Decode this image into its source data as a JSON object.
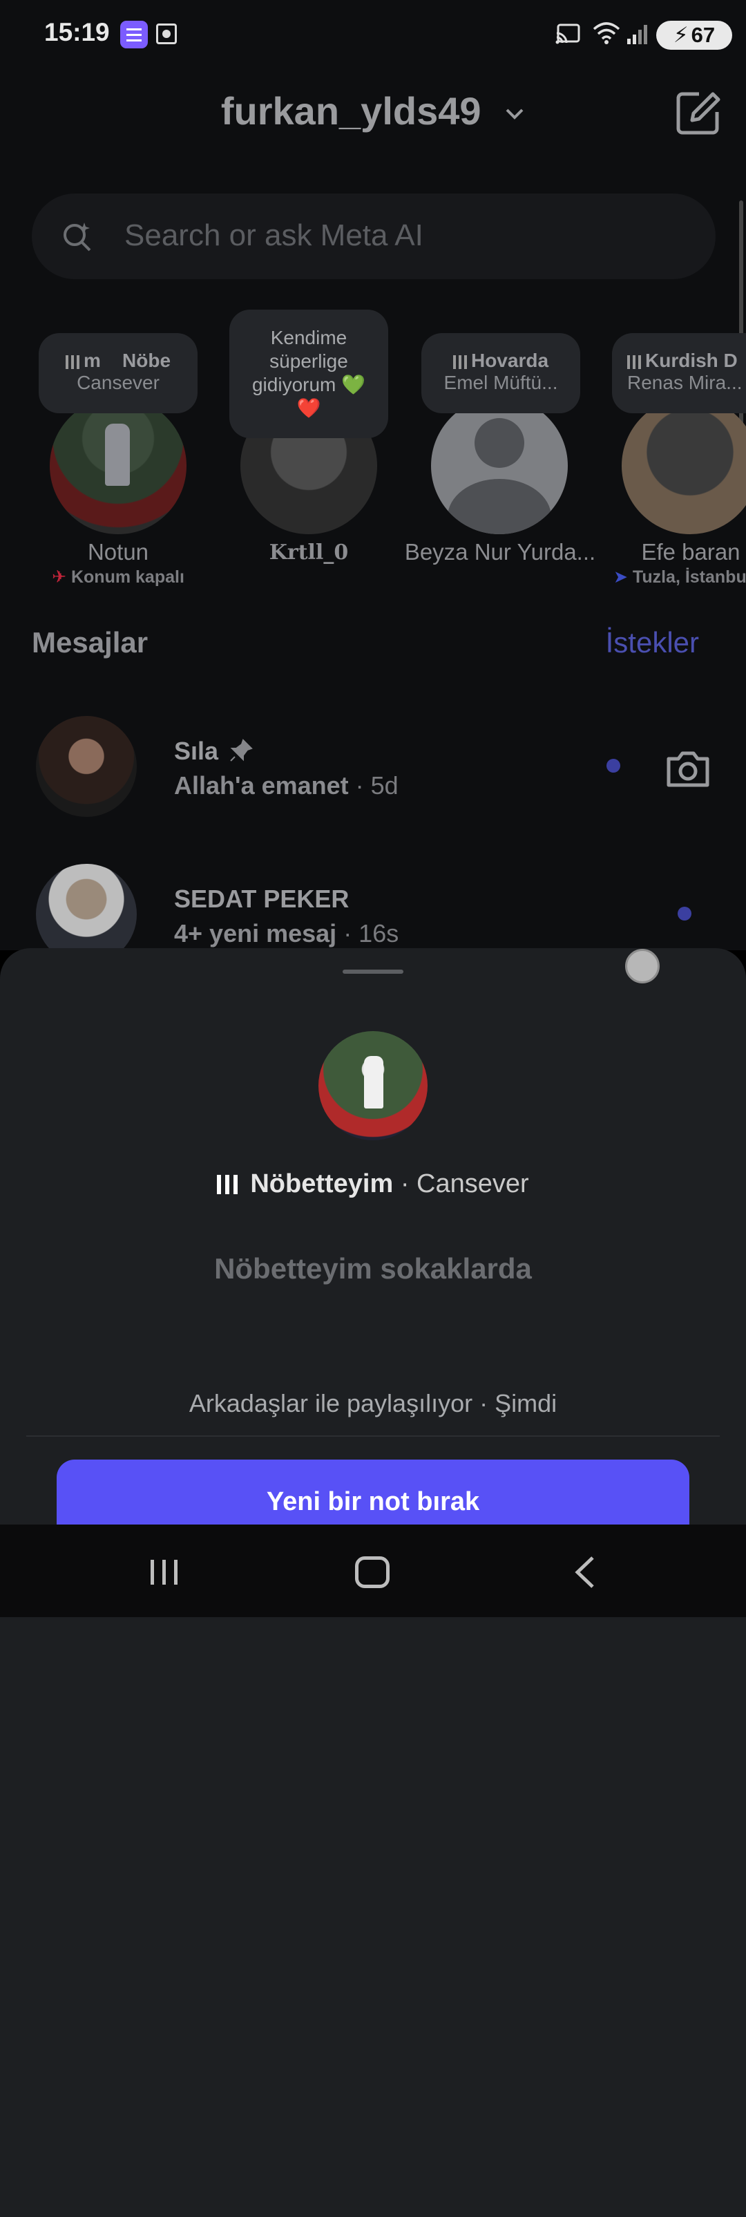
{
  "status_bar": {
    "time": "15:19",
    "battery": "67"
  },
  "header": {
    "title": "furkan_ylds49"
  },
  "search": {
    "placeholder": "Search or ask Meta AI"
  },
  "notes": [
    {
      "bubble_title": "Nöbe",
      "bubble_title_prefix": "m",
      "bubble_sub": "Cansever",
      "name": "Notun",
      "location": "Konum kapalı"
    },
    {
      "bubble_text": "Kendime süperlige gidiyorum 💚 ❤️",
      "name": "Krtll_0"
    },
    {
      "bubble_title": "Hovarda",
      "bubble_sub": "Emel Müftü...",
      "name": "Beyza Nur Yurda..."
    },
    {
      "bubble_title": "Kurdish D",
      "bubble_sub": "Renas Mira...",
      "name": "Efe baran",
      "location": "Tuzla, İstanbu"
    }
  ],
  "section": {
    "title": "Mesajlar",
    "requests": "İstekler"
  },
  "messages": [
    {
      "name": "Sıla",
      "preview": "Allah'a emanet",
      "time": "· 5d"
    },
    {
      "name": "SEDAT PEKER",
      "preview": "4+ yeni mesaj",
      "time": "· 16s"
    }
  ],
  "sheet": {
    "song": "Nöbetteyim",
    "artist": "· Cansever",
    "note": "Nöbetteyim sokaklarda",
    "shared": "Arkadaşlar ile paylaşılıyor · Şimdi",
    "button": "Yeni bir not bırak"
  },
  "colors": {
    "accent": "#5851f6",
    "sheet_bg": "#1d1f22",
    "requests": "#4a4fb0",
    "unread_dot": "#3b3fa0"
  },
  "icons": [
    "compose-icon",
    "search-icon",
    "pin-icon",
    "camera-icon",
    "location-off-icon",
    "location-arrow-icon",
    "music-bars-icon",
    "recents-icon",
    "home-icon",
    "back-icon"
  ]
}
